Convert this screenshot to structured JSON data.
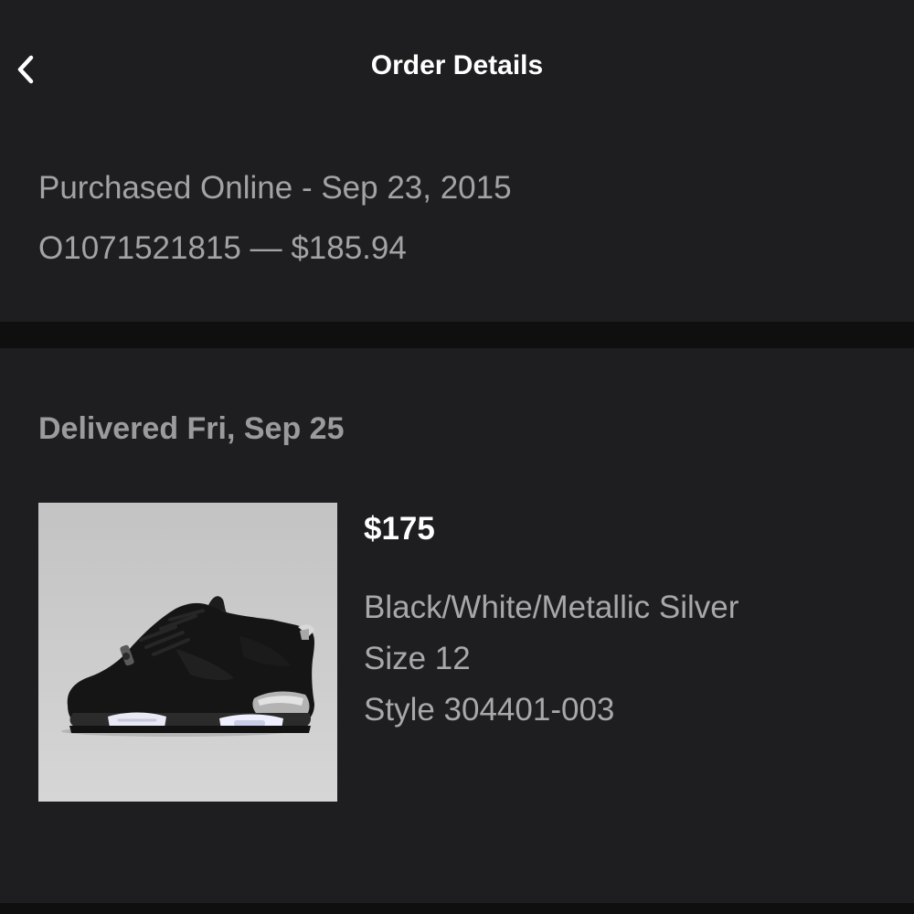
{
  "header": {
    "title": "Order Details",
    "back_icon": "chevron-left-icon"
  },
  "purchase": {
    "summary": "Purchased Online - Sep 23, 2015",
    "order_line": "O1071521815 — $185.94"
  },
  "shipment": {
    "status": "Delivered Fri, Sep 25",
    "item": {
      "price": "$175",
      "color": "Black/White/Metallic Silver",
      "size": "Size 12",
      "style": "Style 304401-003",
      "image": "sneaker-product-image"
    }
  },
  "colors": {
    "background": "#1e1e20",
    "divider": "#0f0f10",
    "primary_text": "#ffffff",
    "secondary_text": "#a3a3a6"
  }
}
